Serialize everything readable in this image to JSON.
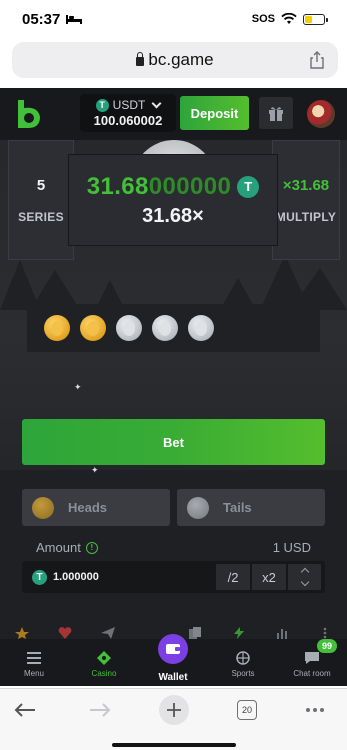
{
  "status_bar": {
    "time": "05:37",
    "sos": "SOS"
  },
  "browser": {
    "url": "bc.game",
    "tab_count": "20"
  },
  "header": {
    "currency": "USDT",
    "currency_symbol": "T",
    "balance": "100.060002",
    "deposit_label": "Deposit"
  },
  "game": {
    "series_value": "5",
    "series_label": "SERIES",
    "multiply_value": "×31.68",
    "multiply_label": "MULTIPLY",
    "payout_bright": "31.68",
    "payout_dim": "000000",
    "multiplier": "31.68×",
    "coins": [
      "gold",
      "gold",
      "silver",
      "silver",
      "silver"
    ]
  },
  "controls": {
    "bet_label": "Bet",
    "heads_label": "Heads",
    "tails_label": "Tails",
    "amount_label": "Amount",
    "amount_usd": "1 USD",
    "amount_value": "1.000000",
    "half_label": "/2",
    "double_label": "x2"
  },
  "nav": {
    "menu": "Menu",
    "casino": "Casino",
    "wallet": "Wallet",
    "sports": "Sports",
    "chat": "Chat room",
    "chat_badge": "99"
  },
  "colors": {
    "accent_green": "#43c03a",
    "wallet_purple": "#7b3fe4",
    "usdt_teal": "#26a17b"
  }
}
